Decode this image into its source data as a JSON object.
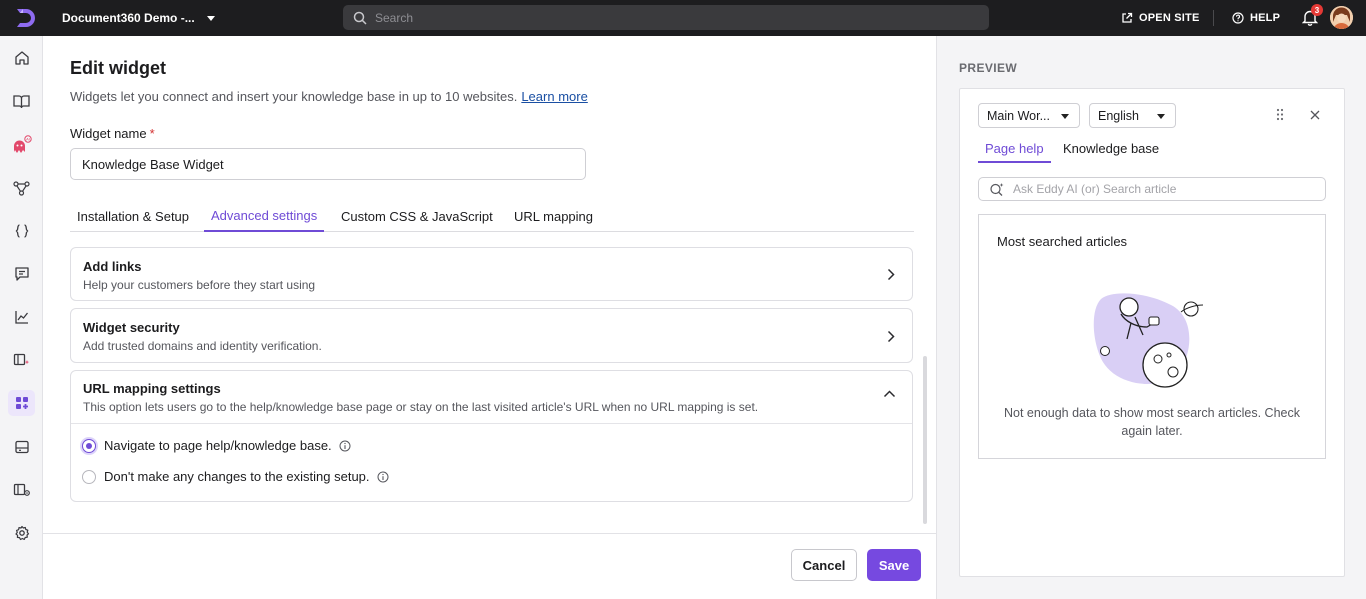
{
  "topbar": {
    "project_name": "Document360 Demo -...",
    "search_placeholder": "Search",
    "open_site_label": "OPEN SITE",
    "help_label": "HELP",
    "notification_count": "3"
  },
  "sidebar": {
    "items": [
      {
        "icon": "home-icon"
      },
      {
        "icon": "book-icon"
      },
      {
        "icon": "eddy-ai-icon"
      },
      {
        "icon": "workflow-icon"
      },
      {
        "icon": "api-braces-icon"
      },
      {
        "icon": "feedback-icon"
      },
      {
        "icon": "analytics-icon"
      },
      {
        "icon": "knowledge-base-assistant-icon"
      },
      {
        "icon": "widgets-icon",
        "active": true
      },
      {
        "icon": "portal-icon"
      },
      {
        "icon": "site-settings-icon"
      },
      {
        "icon": "settings-gear-icon"
      }
    ]
  },
  "main": {
    "title": "Edit widget",
    "description": "Widgets let you connect and insert your knowledge base in up to 10 websites.",
    "learn_more": "Learn more",
    "widget_name_label": "Widget name",
    "required_mark": "*",
    "widget_name_value": "Knowledge Base Widget",
    "tabs": [
      {
        "label": "Installation & Setup"
      },
      {
        "label": "Advanced settings",
        "active": true
      },
      {
        "label": "Custom CSS & JavaScript"
      },
      {
        "label": "URL mapping"
      }
    ],
    "cards": {
      "add_links": {
        "title": "Add links",
        "subtitle": "Help your customers before they start using"
      },
      "widget_security": {
        "title": "Widget security",
        "subtitle": "Add trusted domains and identity verification."
      },
      "url_mapping": {
        "title": "URL mapping settings",
        "subtitle": "This option lets users go to the help/knowledge base page or stay on the last visited article's URL when no URL mapping is set.",
        "options": [
          {
            "label": "Navigate to page help/knowledge base.",
            "selected": true
          },
          {
            "label": "Don't make any changes to the existing setup.",
            "selected": false
          }
        ]
      }
    },
    "footer": {
      "cancel_label": "Cancel",
      "save_label": "Save"
    }
  },
  "preview": {
    "label": "PREVIEW",
    "workspace_select": "Main Wor...",
    "language_select": "English",
    "tabs": [
      {
        "label": "Page help",
        "active": true
      },
      {
        "label": "Knowledge base"
      }
    ],
    "search_placeholder": "Ask Eddy AI (or) Search article",
    "articles_title": "Most searched articles",
    "articles_empty": "Not enough data to show most search articles. Check again later."
  },
  "colors": {
    "accent": "#6f4bd6",
    "save_button": "#7649e0",
    "topbar": "#1d1d1f",
    "badge": "#e53935",
    "link": "#1a4fa3"
  }
}
